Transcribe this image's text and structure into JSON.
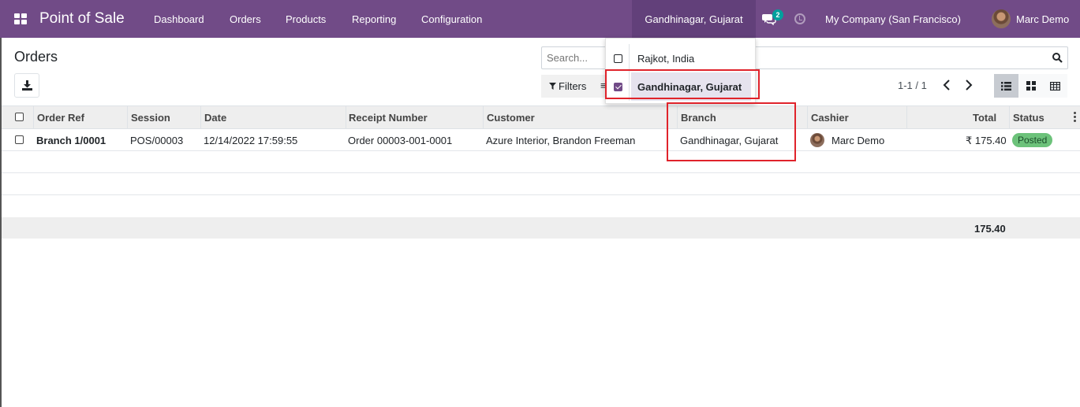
{
  "navbar": {
    "app_title": "Point of Sale",
    "menu": [
      "Dashboard",
      "Orders",
      "Products",
      "Reporting",
      "Configuration"
    ],
    "branch_selector": "Gandhinagar, Gujarat",
    "messages_count": "2",
    "company": "My Company (San Francisco)",
    "user": "Marc Demo",
    "color": "#714b87"
  },
  "branch_dropdown": {
    "items": [
      {
        "label": "Rajkot, India",
        "checked": false
      },
      {
        "label": "Gandhinagar, Gujarat",
        "checked": true
      }
    ]
  },
  "control_panel": {
    "title": "Orders",
    "search_placeholder": "Search...",
    "filters_label": "Filters",
    "pager": "1-1 / 1"
  },
  "table": {
    "columns": [
      "Order Ref",
      "Session",
      "Date",
      "Receipt Number",
      "Customer",
      "Branch",
      "Cashier",
      "Total",
      "Status"
    ],
    "rows": [
      {
        "order_ref": "Branch 1/0001",
        "session": "POS/00003",
        "date": "12/14/2022 17:59:55",
        "receipt": "Order 00003-001-0001",
        "customer": "Azure Interior, Brandon Freeman",
        "branch": "Gandhinagar, Gujarat",
        "cashier": "Marc Demo",
        "total": "₹ 175.40",
        "status": "Posted"
      }
    ],
    "sum_total": "175.40"
  }
}
